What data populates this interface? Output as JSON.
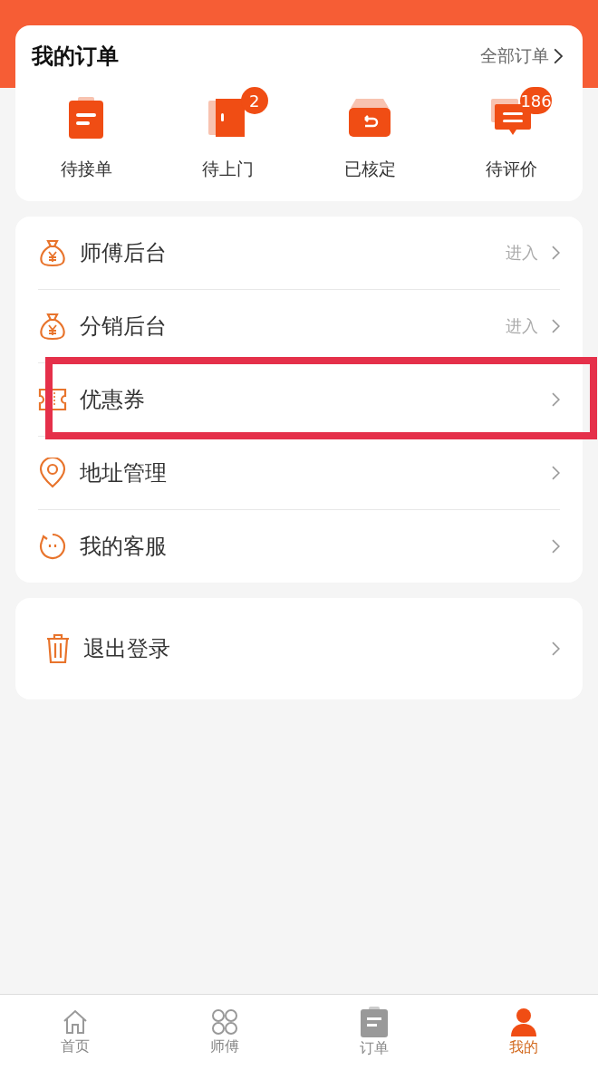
{
  "orders": {
    "title": "我的订单",
    "all_link": "全部订单",
    "items": [
      {
        "kind": "clipboard",
        "label": "待接单"
      },
      {
        "kind": "door",
        "label": "待上门",
        "badge": "2"
      },
      {
        "kind": "box",
        "label": "已核定"
      },
      {
        "kind": "chat",
        "label": "待评价",
        "badge": "186"
      }
    ]
  },
  "menu": [
    {
      "kind": "moneybag",
      "label": "师傅后台",
      "action": "进入",
      "highlighted": false
    },
    {
      "kind": "moneybag",
      "label": "分销后台",
      "action": "进入",
      "highlighted": false
    },
    {
      "kind": "ticket",
      "label": "优惠券",
      "highlighted": true
    },
    {
      "kind": "pin",
      "label": "地址管理",
      "highlighted": false
    },
    {
      "kind": "service",
      "label": "我的客服",
      "highlighted": false
    }
  ],
  "logout": {
    "label": "退出登录"
  },
  "tabbar": [
    {
      "kind": "home",
      "label": "首页",
      "selected": false
    },
    {
      "kind": "clover",
      "label": "师傅",
      "selected": false
    },
    {
      "kind": "orders",
      "label": "订单",
      "selected": false
    },
    {
      "kind": "user",
      "label": "我的",
      "selected": true
    }
  ]
}
